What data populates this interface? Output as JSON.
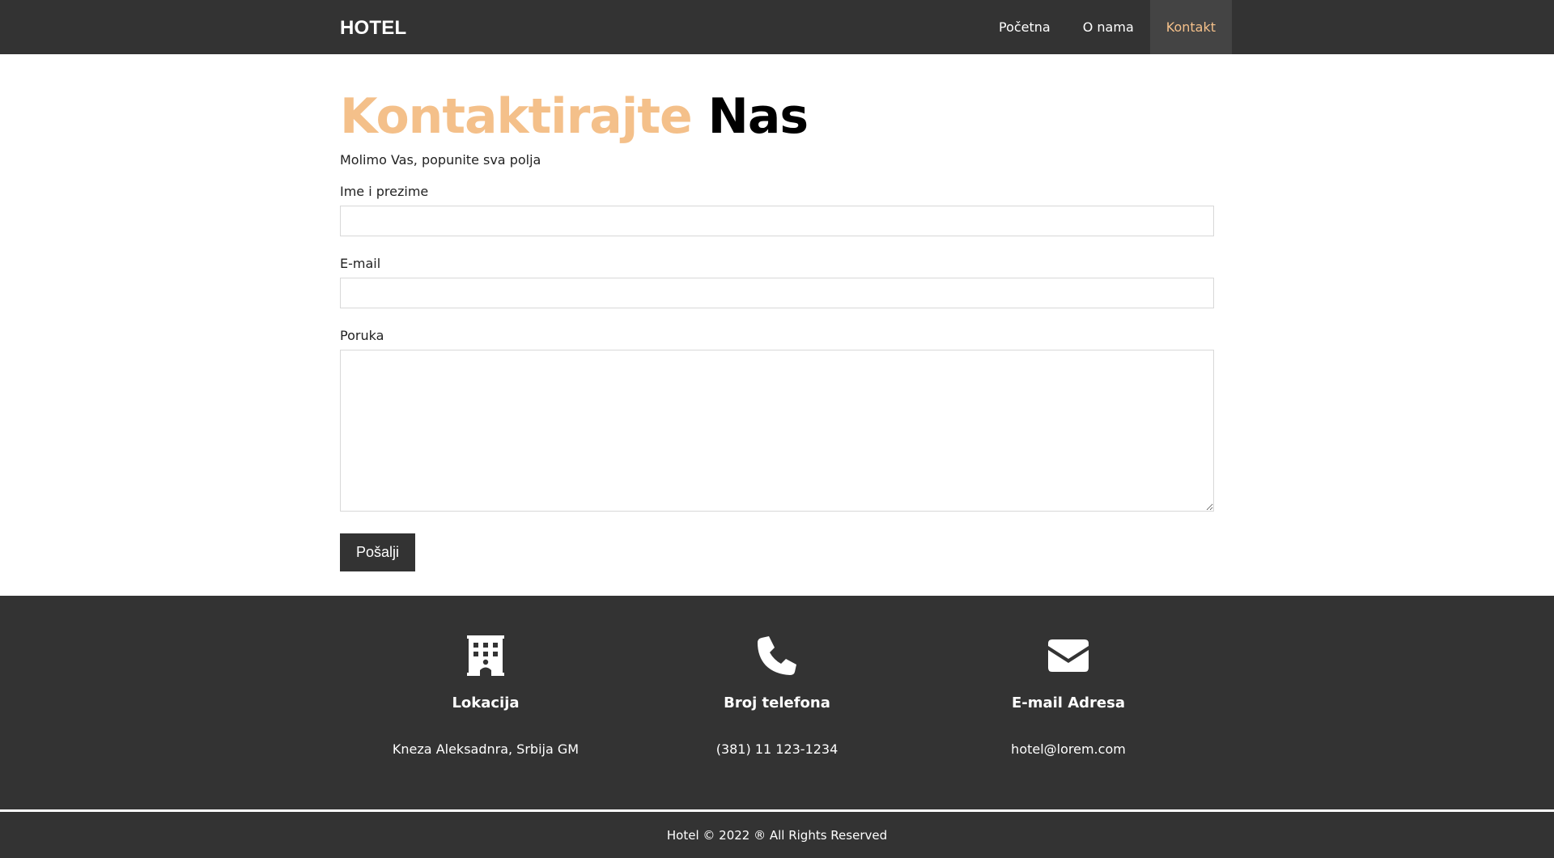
{
  "nav": {
    "brand": "HOTEL",
    "items": [
      {
        "label": "Početna"
      },
      {
        "label": "O nama"
      },
      {
        "label": "Kontakt"
      }
    ]
  },
  "contact": {
    "title_accent": "Kontaktirajte",
    "title_rest": "Nas",
    "subtitle": "Molimo Vas, popunite sva polja",
    "name_label": "Ime i prezime",
    "name_value": "",
    "email_label": "E-mail",
    "email_value": "",
    "message_label": "Poruka",
    "message_value": "",
    "send_label": "Pošalji"
  },
  "footer": {
    "columns": [
      {
        "icon": "building-icon",
        "heading": "Lokacija",
        "value": "Kneza Aleksadnra, Srbija GM"
      },
      {
        "icon": "phone-icon",
        "heading": "Broj telefona",
        "value": "(381) 11 123-1234"
      },
      {
        "icon": "envelope-icon",
        "heading": "E-mail Adresa",
        "value": "hotel@lorem.com"
      }
    ],
    "copyright": "Hotel © 2022 ® All Rights Reserved"
  },
  "colors": {
    "dark": "#333333",
    "accent": "#f4c08a",
    "active_tab_bg": "#444444"
  }
}
